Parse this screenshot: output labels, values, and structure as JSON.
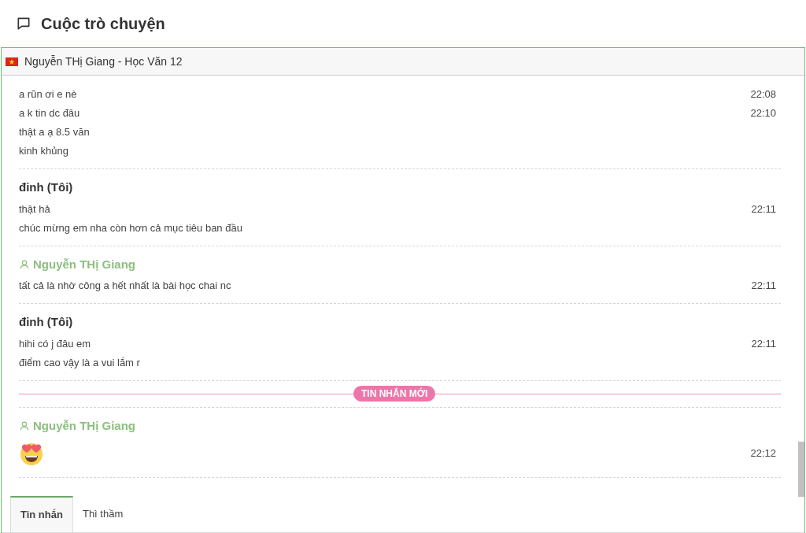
{
  "page_title": "Cuộc trò chuyện",
  "conversation": {
    "title": "Nguyễn THị Giang - Học Văn 12"
  },
  "feed": [
    {
      "kind": "group",
      "messages": [
        {
          "text": "a rũn ơi e nè",
          "time": "22:08"
        },
        {
          "text": "a k tin dc đâu",
          "time": "22:10"
        },
        {
          "text": "thật a ạ 8.5 văn"
        },
        {
          "text": "kinh khủng"
        }
      ]
    },
    {
      "kind": "group",
      "sender": "đinh (Tôi)",
      "own": true,
      "messages": [
        {
          "text": "thật hả",
          "time": "22:11"
        },
        {
          "text": "chúc mừng em nha còn hơn cả mục tiêu ban đầu"
        }
      ]
    },
    {
      "kind": "group",
      "sender": "Nguyễn THị Giang",
      "own": false,
      "messages": [
        {
          "text": "tất cả là nhờ công a hết nhất là bài học chai nc",
          "time": "22:11"
        }
      ]
    },
    {
      "kind": "group",
      "sender": "đinh (Tôi)",
      "own": true,
      "messages": [
        {
          "text": "hihi có j đâu em",
          "time": "22:11"
        },
        {
          "text": "điểm cao vậy là a vui lắm r"
        }
      ]
    },
    {
      "kind": "new_marker",
      "label": "TIN NHẮN MỚI"
    },
    {
      "kind": "group",
      "sender": "Nguyễn THị Giang",
      "own": false,
      "messages": [
        {
          "kind": "emoji",
          "time": "22:12"
        }
      ]
    }
  ],
  "tabs": [
    {
      "label": "Tin nhắn",
      "selected": true
    },
    {
      "label": "Thì thầm",
      "selected": false
    }
  ]
}
